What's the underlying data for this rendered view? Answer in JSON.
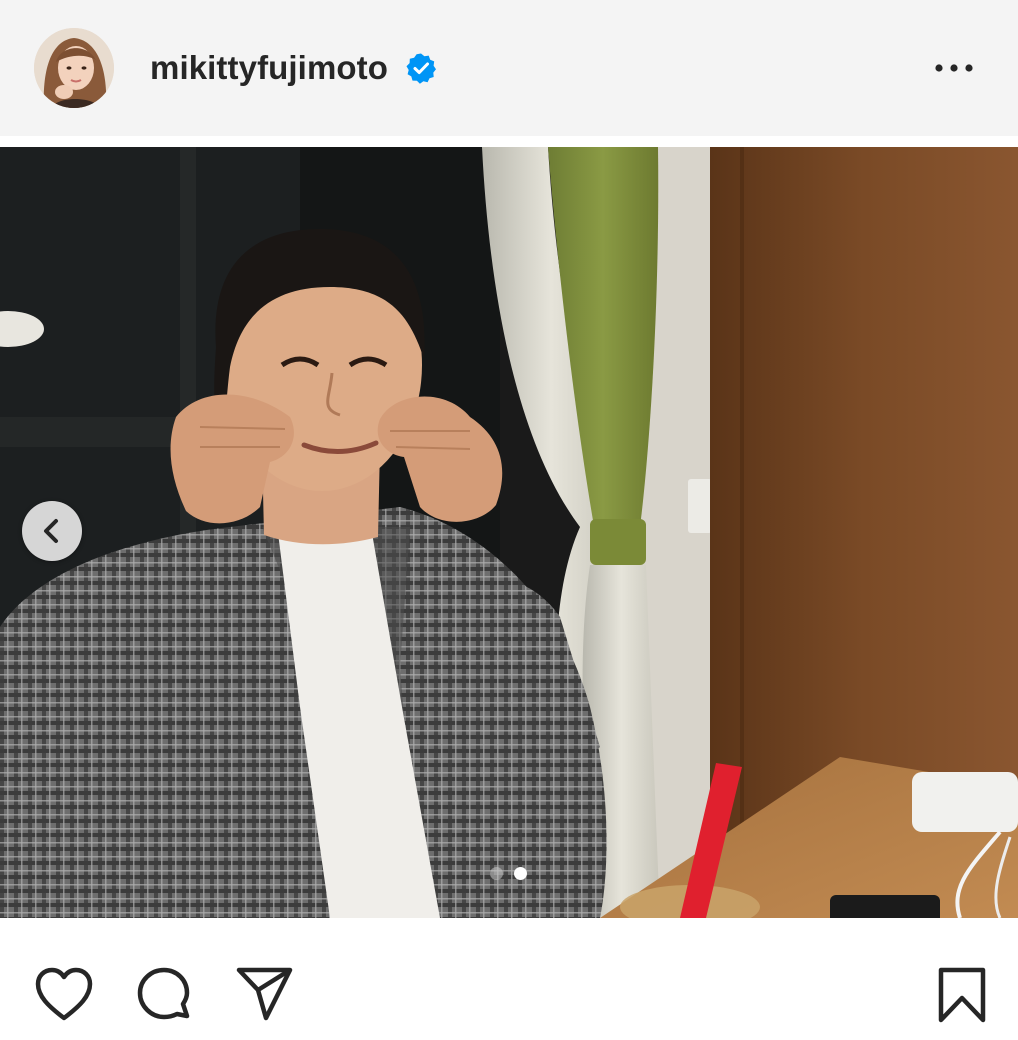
{
  "post": {
    "username": "mikittyfujimoto",
    "verified": true,
    "carousel": {
      "slide_count": 2,
      "active_slide": 2
    }
  },
  "icons": {
    "verified": "verified-badge-icon",
    "more": "more-options-icon",
    "prev": "chevron-left-icon",
    "like": "heart-icon",
    "comment": "comment-icon",
    "share": "paper-plane-icon",
    "save": "bookmark-icon"
  },
  "colors": {
    "verified_blue": "#0095f6",
    "text": "#262626",
    "header_bg": "#f4f4f4"
  }
}
